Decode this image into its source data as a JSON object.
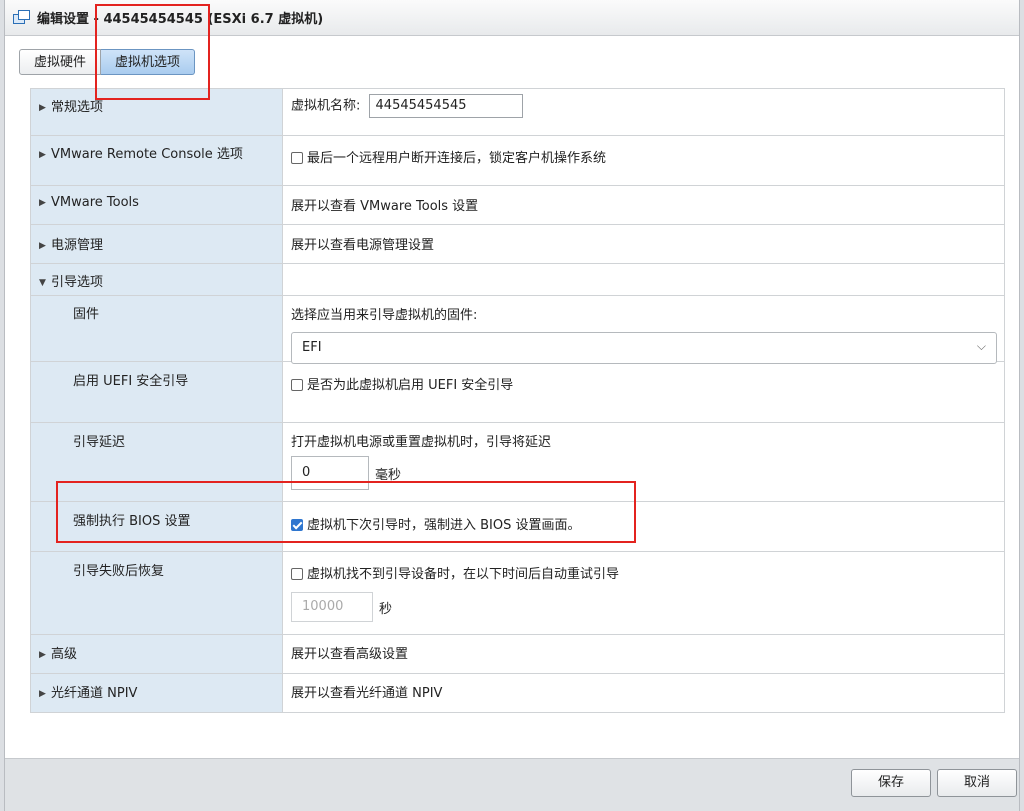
{
  "window": {
    "title": "编辑设置 - 44545454545 (ESXi 6.7 虚拟机)"
  },
  "tabs": [
    {
      "label": "虚拟硬件",
      "active": false
    },
    {
      "label": "虚拟机选项",
      "active": true
    }
  ],
  "rows": {
    "general": {
      "label": "常规选项",
      "vm_name_label": "虚拟机名称:",
      "vm_name_value": "44545454545"
    },
    "vmrc": {
      "label": "VMware Remote Console 选项",
      "checkbox_label": "最后一个远程用户断开连接后，锁定客户机操作系统",
      "checked": false
    },
    "vmtools": {
      "label": "VMware Tools",
      "value": "展开以查看 VMware Tools 设置"
    },
    "power": {
      "label": "电源管理",
      "value": "展开以查看电源管理设置"
    },
    "boot": {
      "label": "引导选项",
      "firmware": {
        "label": "固件",
        "description": "选择应当用来引导虚拟机的固件:",
        "selected": "EFI"
      },
      "uefi_secure": {
        "label": "启用 UEFI 安全引导",
        "checkbox_label": "是否为此虚拟机启用 UEFI 安全引导",
        "checked": false
      },
      "delay": {
        "label": "引导延迟",
        "description": "打开虚拟机电源或重置虚拟机时，引导将延迟",
        "value": "0",
        "unit": "毫秒"
      },
      "force_bios": {
        "label": "强制执行 BIOS 设置",
        "checkbox_label": "虚拟机下次引导时，强制进入 BIOS 设置画面。",
        "checked": true
      },
      "failed_recovery": {
        "label": "引导失败后恢复",
        "checkbox_label": "虚拟机找不到引导设备时，在以下时间后自动重试引导",
        "checked": false,
        "placeholder": "10000",
        "unit": "秒"
      }
    },
    "advanced": {
      "label": "高级",
      "value": "展开以查看高级设置"
    },
    "npiv": {
      "label": "光纤通道 NPIV",
      "value": "展开以查看光纤通道 NPIV"
    }
  },
  "footer": {
    "save_label": "保存",
    "cancel_label": "取消"
  },
  "colors": {
    "annotation_red": "#e3231f",
    "label_bg": "#dde9f3",
    "active_tab": "#a9ccef"
  },
  "icons": {
    "window": "vm-settings-icon",
    "collapsed": "caret-right-icon",
    "expanded": "caret-down-icon",
    "dropdown": "chevron-down-icon"
  }
}
